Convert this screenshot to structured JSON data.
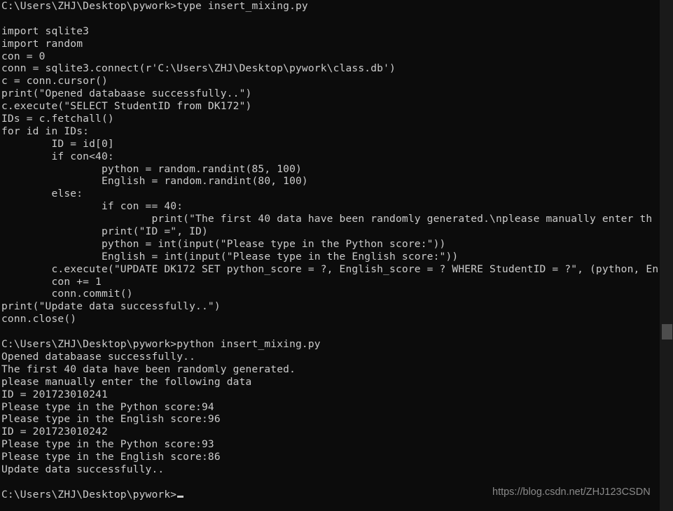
{
  "window": {
    "title": "Command Prompt",
    "background_color": "#0c0c0c",
    "text_color": "#cccccc"
  },
  "scrollbar": {
    "track_color": "#1a1a1a",
    "thumb_color": "#4d4d4d"
  },
  "watermark": {
    "text": "https://blog.csdn.net/ZHJ123CSDN",
    "color": "#8a8a8a"
  },
  "console": {
    "prompt": "C:\\Users\\ZHJ\\Desktop\\pywork>",
    "lines": [
      "C:\\Users\\ZHJ\\Desktop\\pywork>type insert_mixing.py",
      "",
      "import sqlite3",
      "import random",
      "con = 0",
      "conn = sqlite3.connect(r'C:\\Users\\ZHJ\\Desktop\\pywork\\class.db')",
      "c = conn.cursor()",
      "print(\"Opened databaase successfully..\")",
      "c.execute(\"SELECT StudentID from DK172\")",
      "IDs = c.fetchall()",
      "for id in IDs:",
      "        ID = id[0]",
      "        if con<40:",
      "                python = random.randint(85, 100)",
      "                English = random.randint(80, 100)",
      "        else:",
      "                if con == 40:",
      "                        print(\"The first 40 data have been randomly generated.\\nplease manually enter th",
      "                print(\"ID =\", ID)",
      "                python = int(input(\"Please type in the Python score:\"))",
      "                English = int(input(\"Please type in the English score:\"))",
      "        c.execute(\"UPDATE DK172 SET python_score = ?, English_score = ? WHERE StudentID = ?\", (python, En",
      "        con += 1",
      "        conn.commit()",
      "print(\"Update data successfully..\")",
      "conn.close()",
      "",
      "C:\\Users\\ZHJ\\Desktop\\pywork>python insert_mixing.py",
      "Opened databaase successfully..",
      "The first 40 data have been randomly generated.",
      "please manually enter the following data",
      "ID = 201723010241",
      "Please type in the Python score:94",
      "Please type in the English score:96",
      "ID = 201723010242",
      "Please type in the Python score:93",
      "Please type in the English score:86",
      "Update data successfully..",
      ""
    ],
    "final_prompt": "C:\\Users\\ZHJ\\Desktop\\pywork>"
  }
}
